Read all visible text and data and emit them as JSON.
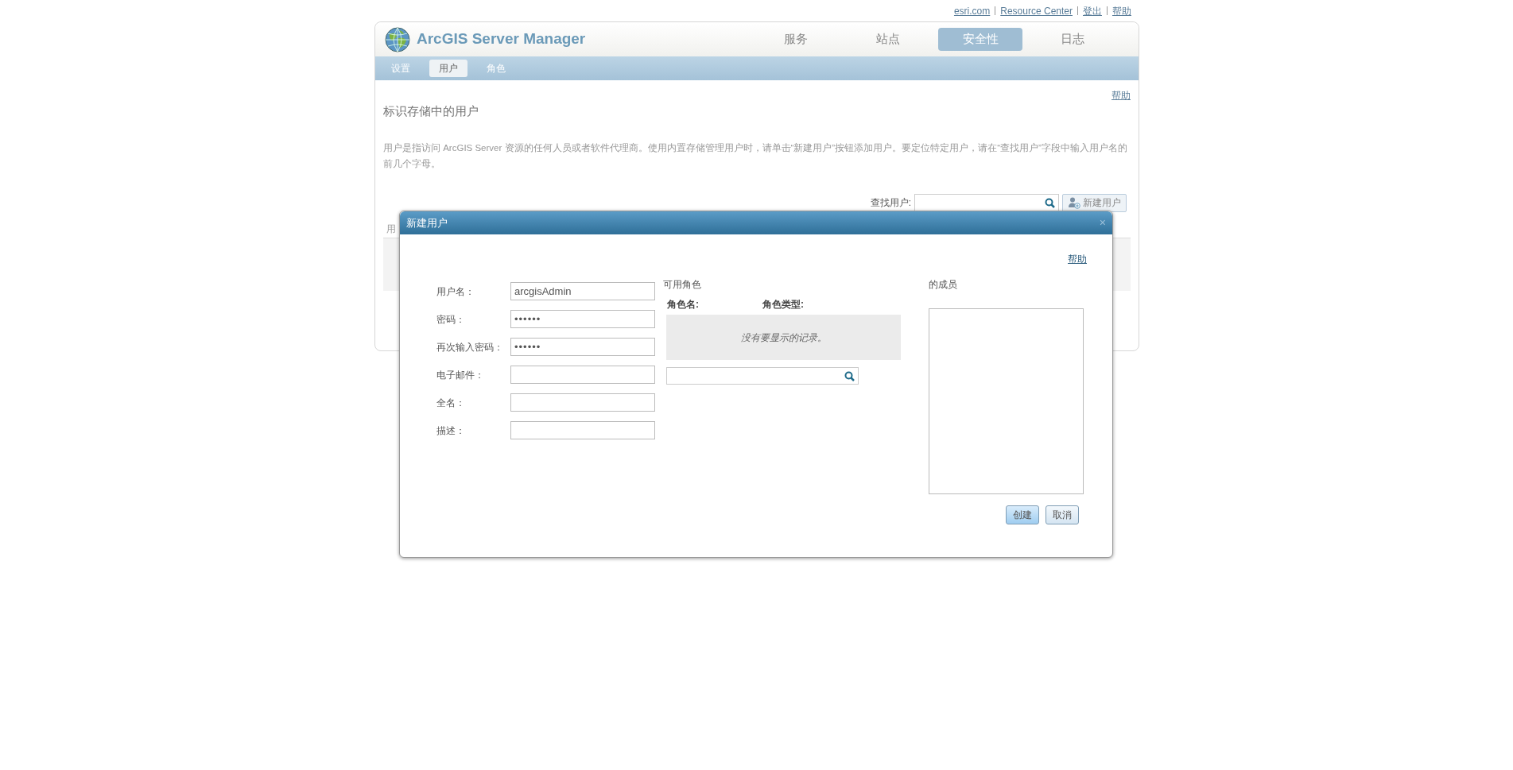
{
  "top_links": [
    {
      "label": "esri.com"
    },
    {
      "label": "Resource Center"
    },
    {
      "label": "登出"
    },
    {
      "label": "帮助"
    }
  ],
  "app_title": "ArcGIS Server Manager",
  "main_tabs": [
    {
      "label": "服务",
      "selected": false
    },
    {
      "label": "站点",
      "selected": false
    },
    {
      "label": "安全性",
      "selected": true
    },
    {
      "label": "日志",
      "selected": false
    }
  ],
  "sub_tabs": [
    {
      "label": "设置",
      "selected": false
    },
    {
      "label": "用户",
      "selected": true
    },
    {
      "label": "角色",
      "selected": false
    }
  ],
  "page": {
    "help": "帮助",
    "heading": "标识存储中的用户",
    "description": "用户是指访问 ArcGIS Server 资源的任何人员或者软件代理商。使用内置存储管理用户时，请单击“新建用户”按钮添加用户。要定位特定用户，请在“查找用户”字段中输入用户名的前几个字母。",
    "search_label": "查找用户:",
    "new_user_button": "新建用户",
    "column_1": "用"
  },
  "dialog": {
    "title": "新建用户",
    "close": "×",
    "help": "帮助",
    "fields": [
      {
        "label": "用户名：",
        "value": "arcgisAdmin",
        "kind": "text"
      },
      {
        "label": "密码：",
        "value": "••••••",
        "kind": "password"
      },
      {
        "label": "再次输入密码：",
        "value": "••••••",
        "kind": "password"
      },
      {
        "label": "电子邮件：",
        "kind": "text"
      },
      {
        "label": "全名：",
        "kind": "text"
      },
      {
        "label": "描述：",
        "kind": "text"
      }
    ],
    "available_roles": {
      "title": "可用角色",
      "columns": [
        "角色名:",
        "角色类型:"
      ],
      "empty_message": "没有要显示的记录。"
    },
    "members_title": "的成员",
    "buttons": [
      {
        "label": "创建",
        "primary": true
      },
      {
        "label": "取消",
        "primary": false
      }
    ]
  }
}
